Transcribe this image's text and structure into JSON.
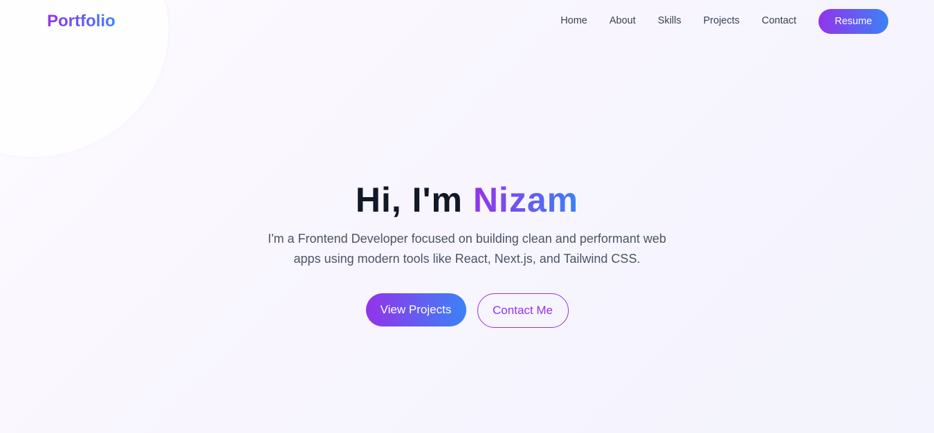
{
  "nav": {
    "logo": "Portfolio",
    "links": [
      "Home",
      "About",
      "Skills",
      "Projects",
      "Contact"
    ],
    "resume_label": "Resume"
  },
  "hero": {
    "greeting": "Hi, I'm",
    "name": "Nizam",
    "description": "I'm a Frontend Developer focused on building clean and performant web apps using modern tools like React, Next.js, and Tailwind CSS.",
    "primary_cta": "View Projects",
    "secondary_cta": "Contact Me"
  },
  "colors": {
    "gradient_start": "#9333ea",
    "gradient_end": "#3b82f6",
    "heading": "#111827",
    "body_text": "#4b5563"
  }
}
